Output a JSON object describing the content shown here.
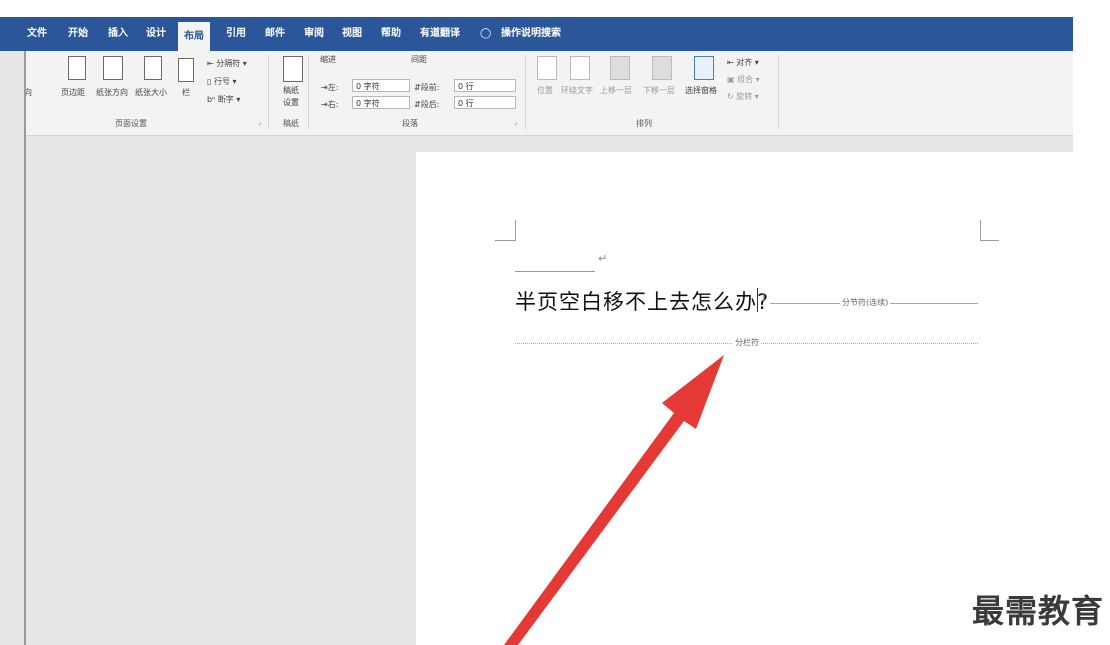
{
  "menu": {
    "items": [
      "文件",
      "开始",
      "插入",
      "设计",
      "布局",
      "引用",
      "邮件",
      "审阅",
      "视图",
      "帮助",
      "有道翻译"
    ],
    "active": "布局",
    "search_label": "操作说明搜索"
  },
  "ribbon": {
    "page_setup": {
      "text_direction": "文字方向",
      "margins": "页边距",
      "orientation": "纸张方向",
      "size": "纸张大小",
      "columns": "栏",
      "breaks": "分隔符",
      "line_numbers": "行号",
      "hyphenation": "断字",
      "group_label": "页面设置"
    },
    "draft": {
      "button_line1": "稿纸",
      "button_line2": "设置",
      "group_label": "稿纸"
    },
    "paragraph": {
      "indent_label": "缩进",
      "spacing_label": "间距",
      "left_label": "左:",
      "left_value": "0 字符",
      "right_label": "右:",
      "right_value": "0 字符",
      "before_label": "段前:",
      "before_value": "0 行",
      "after_label": "段后:",
      "after_value": "0 行",
      "group_label": "段落"
    },
    "arrange": {
      "position": "位置",
      "wrap_text": "环绕文字",
      "bring_forward": "上移一层",
      "send_backward": "下移一层",
      "selection_pane": "选择窗格",
      "align": "对齐",
      "group": "组合",
      "rotate": "旋转",
      "group_label": "排列"
    }
  },
  "document": {
    "heading": "半页空白移不上去怎么办?",
    "section_break_label": "分节符(连续)",
    "column_break_label": "分栏符"
  },
  "watermark": "最需教育",
  "colors": {
    "title_bar": "#2b579a",
    "ribbon_bg": "#f3f3f3",
    "arrow": "#e53935"
  }
}
